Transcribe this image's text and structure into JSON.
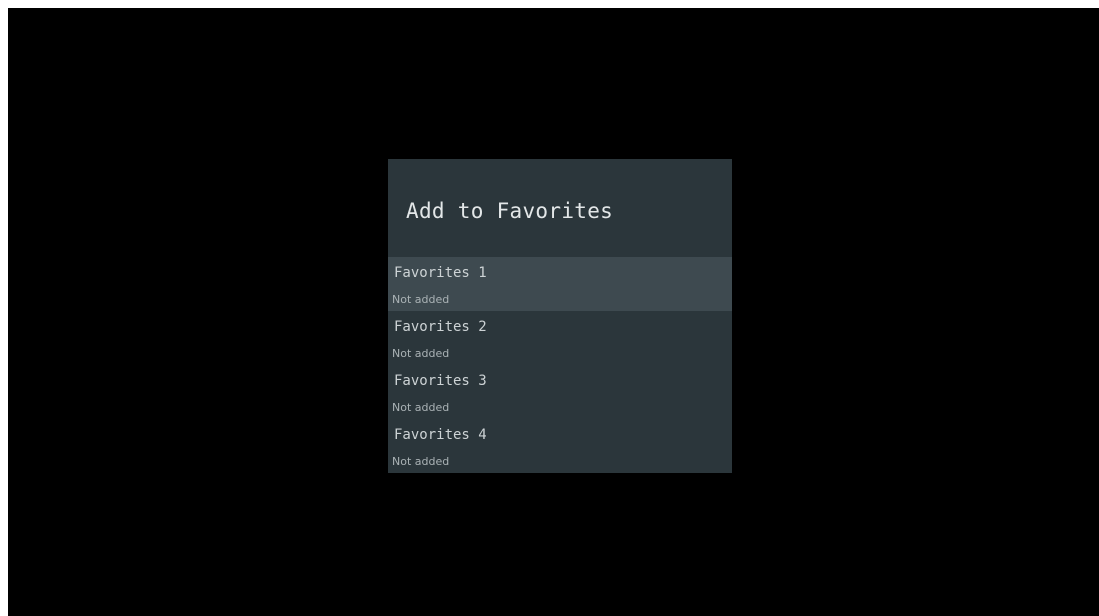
{
  "dialog": {
    "title": "Add to Favorites",
    "items": [
      {
        "label": "Favorites 1",
        "status": "Not added",
        "focused": true
      },
      {
        "label": "Favorites 2",
        "status": "Not added",
        "focused": false
      },
      {
        "label": "Favorites 3",
        "status": "Not added",
        "focused": false
      },
      {
        "label": "Favorites 4",
        "status": "Not added",
        "focused": false
      }
    ]
  },
  "colors": {
    "screen_background": "#000000",
    "dialog_background": "#2b363b",
    "focused_item_background": "#3e4a50",
    "title_text": "#e3e7e8",
    "item_text": "#cdd3d5",
    "subtext": "#aab2b5"
  }
}
